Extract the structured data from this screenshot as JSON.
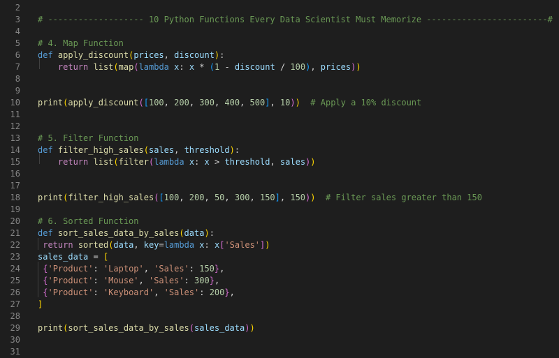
{
  "colors": {
    "background": "#1e1e1e",
    "line_number": "#858585",
    "indent_guide": "#404040",
    "comment": "#6a9955",
    "keyword": "#569cd6",
    "control": "#c586c0",
    "function": "#dcdcaa",
    "param": "#9cdcfe",
    "number": "#b5cea8",
    "string": "#ce9178",
    "plain": "#d4d4d4",
    "bracket1": "#ffd700",
    "bracket2": "#da70d6",
    "bracket3": "#179fff"
  },
  "editor": {
    "lines": [
      {
        "n": "2",
        "tokens": []
      },
      {
        "n": "3",
        "tokens": [
          [
            "comment",
            "# ------------------- 10 Python Functions Every Data Scientist Must Memorize ------------------------#"
          ]
        ]
      },
      {
        "n": "4",
        "tokens": []
      },
      {
        "n": "5",
        "tokens": [
          [
            "comment",
            "# 4. Map Function"
          ]
        ]
      },
      {
        "n": "6",
        "tokens": [
          [
            "keyword",
            "def"
          ],
          [
            "plain",
            " "
          ],
          [
            "function",
            "apply_discount"
          ],
          [
            "bracket1",
            "("
          ],
          [
            "param",
            "prices"
          ],
          [
            "plain",
            ", "
          ],
          [
            "param",
            "discount"
          ],
          [
            "bracket1",
            ")"
          ],
          [
            "plain",
            ":"
          ]
        ]
      },
      {
        "n": "7",
        "tokens": [
          [
            "plain",
            "    "
          ],
          [
            "control",
            "return"
          ],
          [
            "plain",
            " "
          ],
          [
            "function",
            "list"
          ],
          [
            "bracket1",
            "("
          ],
          [
            "function",
            "map"
          ],
          [
            "bracket2",
            "("
          ],
          [
            "keyword",
            "lambda"
          ],
          [
            "plain",
            " "
          ],
          [
            "param",
            "x"
          ],
          [
            "plain",
            ": "
          ],
          [
            "param",
            "x"
          ],
          [
            "plain",
            " * "
          ],
          [
            "bracket3",
            "("
          ],
          [
            "number",
            "1"
          ],
          [
            "plain",
            " - "
          ],
          [
            "param",
            "discount"
          ],
          [
            "plain",
            " / "
          ],
          [
            "number",
            "100"
          ],
          [
            "bracket3",
            ")"
          ],
          [
            "plain",
            ", "
          ],
          [
            "param",
            "prices"
          ],
          [
            "bracket2",
            ")"
          ],
          [
            "bracket1",
            ")"
          ]
        ]
      },
      {
        "n": "8",
        "tokens": []
      },
      {
        "n": "9",
        "tokens": []
      },
      {
        "n": "10",
        "tokens": [
          [
            "function",
            "print"
          ],
          [
            "bracket1",
            "("
          ],
          [
            "function",
            "apply_discount"
          ],
          [
            "bracket2",
            "("
          ],
          [
            "bracket3",
            "["
          ],
          [
            "number",
            "100"
          ],
          [
            "plain",
            ", "
          ],
          [
            "number",
            "200"
          ],
          [
            "plain",
            ", "
          ],
          [
            "number",
            "300"
          ],
          [
            "plain",
            ", "
          ],
          [
            "number",
            "400"
          ],
          [
            "plain",
            ", "
          ],
          [
            "number",
            "500"
          ],
          [
            "bracket3",
            "]"
          ],
          [
            "plain",
            ", "
          ],
          [
            "number",
            "10"
          ],
          [
            "bracket2",
            ")"
          ],
          [
            "bracket1",
            ")"
          ],
          [
            "plain",
            "  "
          ],
          [
            "comment",
            "# Apply a 10% discount"
          ]
        ]
      },
      {
        "n": "11",
        "tokens": []
      },
      {
        "n": "12",
        "tokens": []
      },
      {
        "n": "13",
        "tokens": [
          [
            "comment",
            "# 5. Filter Function"
          ]
        ]
      },
      {
        "n": "14",
        "tokens": [
          [
            "keyword",
            "def"
          ],
          [
            "plain",
            " "
          ],
          [
            "function",
            "filter_high_sales"
          ],
          [
            "bracket1",
            "("
          ],
          [
            "param",
            "sales"
          ],
          [
            "plain",
            ", "
          ],
          [
            "param",
            "threshold"
          ],
          [
            "bracket1",
            ")"
          ],
          [
            "plain",
            ":"
          ]
        ]
      },
      {
        "n": "15",
        "tokens": [
          [
            "plain",
            "    "
          ],
          [
            "control",
            "return"
          ],
          [
            "plain",
            " "
          ],
          [
            "function",
            "list"
          ],
          [
            "bracket1",
            "("
          ],
          [
            "function",
            "filter"
          ],
          [
            "bracket2",
            "("
          ],
          [
            "keyword",
            "lambda"
          ],
          [
            "plain",
            " "
          ],
          [
            "param",
            "x"
          ],
          [
            "plain",
            ": "
          ],
          [
            "param",
            "x"
          ],
          [
            "plain",
            " > "
          ],
          [
            "param",
            "threshold"
          ],
          [
            "plain",
            ", "
          ],
          [
            "param",
            "sales"
          ],
          [
            "bracket2",
            ")"
          ],
          [
            "bracket1",
            ")"
          ]
        ]
      },
      {
        "n": "16",
        "tokens": []
      },
      {
        "n": "17",
        "tokens": []
      },
      {
        "n": "18",
        "tokens": [
          [
            "function",
            "print"
          ],
          [
            "bracket1",
            "("
          ],
          [
            "function",
            "filter_high_sales"
          ],
          [
            "bracket2",
            "("
          ],
          [
            "bracket3",
            "["
          ],
          [
            "number",
            "100"
          ],
          [
            "plain",
            ", "
          ],
          [
            "number",
            "200"
          ],
          [
            "plain",
            ", "
          ],
          [
            "number",
            "50"
          ],
          [
            "plain",
            ", "
          ],
          [
            "number",
            "300"
          ],
          [
            "plain",
            ", "
          ],
          [
            "number",
            "150"
          ],
          [
            "bracket3",
            "]"
          ],
          [
            "plain",
            ", "
          ],
          [
            "number",
            "150"
          ],
          [
            "bracket2",
            ")"
          ],
          [
            "bracket1",
            ")"
          ],
          [
            "plain",
            "  "
          ],
          [
            "comment",
            "# Filter sales greater than 150"
          ]
        ]
      },
      {
        "n": "19",
        "tokens": []
      },
      {
        "n": "20",
        "tokens": [
          [
            "comment",
            "# 6. Sorted Function"
          ]
        ]
      },
      {
        "n": "21",
        "tokens": [
          [
            "keyword",
            "def"
          ],
          [
            "plain",
            " "
          ],
          [
            "function",
            "sort_sales_data_by_sales"
          ],
          [
            "bracket1",
            "("
          ],
          [
            "param",
            "data"
          ],
          [
            "bracket1",
            ")"
          ],
          [
            "plain",
            ":"
          ]
        ]
      },
      {
        "n": "22",
        "tokens": [
          [
            "plain",
            " "
          ],
          [
            "control",
            "return"
          ],
          [
            "plain",
            " "
          ],
          [
            "function",
            "sorted"
          ],
          [
            "bracket1",
            "("
          ],
          [
            "param",
            "data"
          ],
          [
            "plain",
            ", "
          ],
          [
            "param",
            "key"
          ],
          [
            "plain",
            "="
          ],
          [
            "keyword",
            "lambda"
          ],
          [
            "plain",
            " "
          ],
          [
            "param",
            "x"
          ],
          [
            "plain",
            ": "
          ],
          [
            "param",
            "x"
          ],
          [
            "bracket2",
            "["
          ],
          [
            "string",
            "'Sales'"
          ],
          [
            "bracket2",
            "]"
          ],
          [
            "bracket1",
            ")"
          ]
        ]
      },
      {
        "n": "23",
        "tokens": [
          [
            "param",
            "sales_data"
          ],
          [
            "plain",
            " = "
          ],
          [
            "bracket1",
            "["
          ]
        ]
      },
      {
        "n": "24",
        "tokens": [
          [
            "plain",
            " "
          ],
          [
            "bracket2",
            "{"
          ],
          [
            "string",
            "'Product'"
          ],
          [
            "plain",
            ": "
          ],
          [
            "string",
            "'Laptop'"
          ],
          [
            "plain",
            ", "
          ],
          [
            "string",
            "'Sales'"
          ],
          [
            "plain",
            ": "
          ],
          [
            "number",
            "150"
          ],
          [
            "bracket2",
            "}"
          ],
          [
            "plain",
            ","
          ]
        ]
      },
      {
        "n": "25",
        "tokens": [
          [
            "plain",
            " "
          ],
          [
            "bracket2",
            "{"
          ],
          [
            "string",
            "'Product'"
          ],
          [
            "plain",
            ": "
          ],
          [
            "string",
            "'Mouse'"
          ],
          [
            "plain",
            ", "
          ],
          [
            "string",
            "'Sales'"
          ],
          [
            "plain",
            ": "
          ],
          [
            "number",
            "300"
          ],
          [
            "bracket2",
            "}"
          ],
          [
            "plain",
            ","
          ]
        ]
      },
      {
        "n": "26",
        "tokens": [
          [
            "plain",
            " "
          ],
          [
            "bracket2",
            "{"
          ],
          [
            "string",
            "'Product'"
          ],
          [
            "plain",
            ": "
          ],
          [
            "string",
            "'Keyboard'"
          ],
          [
            "plain",
            ", "
          ],
          [
            "string",
            "'Sales'"
          ],
          [
            "plain",
            ": "
          ],
          [
            "number",
            "200"
          ],
          [
            "bracket2",
            "}"
          ],
          [
            "plain",
            ","
          ]
        ]
      },
      {
        "n": "27",
        "tokens": [
          [
            "bracket1",
            "]"
          ]
        ]
      },
      {
        "n": "28",
        "tokens": []
      },
      {
        "n": "29",
        "tokens": [
          [
            "function",
            "print"
          ],
          [
            "bracket1",
            "("
          ],
          [
            "function",
            "sort_sales_data_by_sales"
          ],
          [
            "bracket2",
            "("
          ],
          [
            "param",
            "sales_data"
          ],
          [
            "bracket2",
            ")"
          ],
          [
            "bracket1",
            ")"
          ]
        ]
      },
      {
        "n": "30",
        "tokens": []
      },
      {
        "n": "31",
        "tokens": []
      }
    ]
  }
}
